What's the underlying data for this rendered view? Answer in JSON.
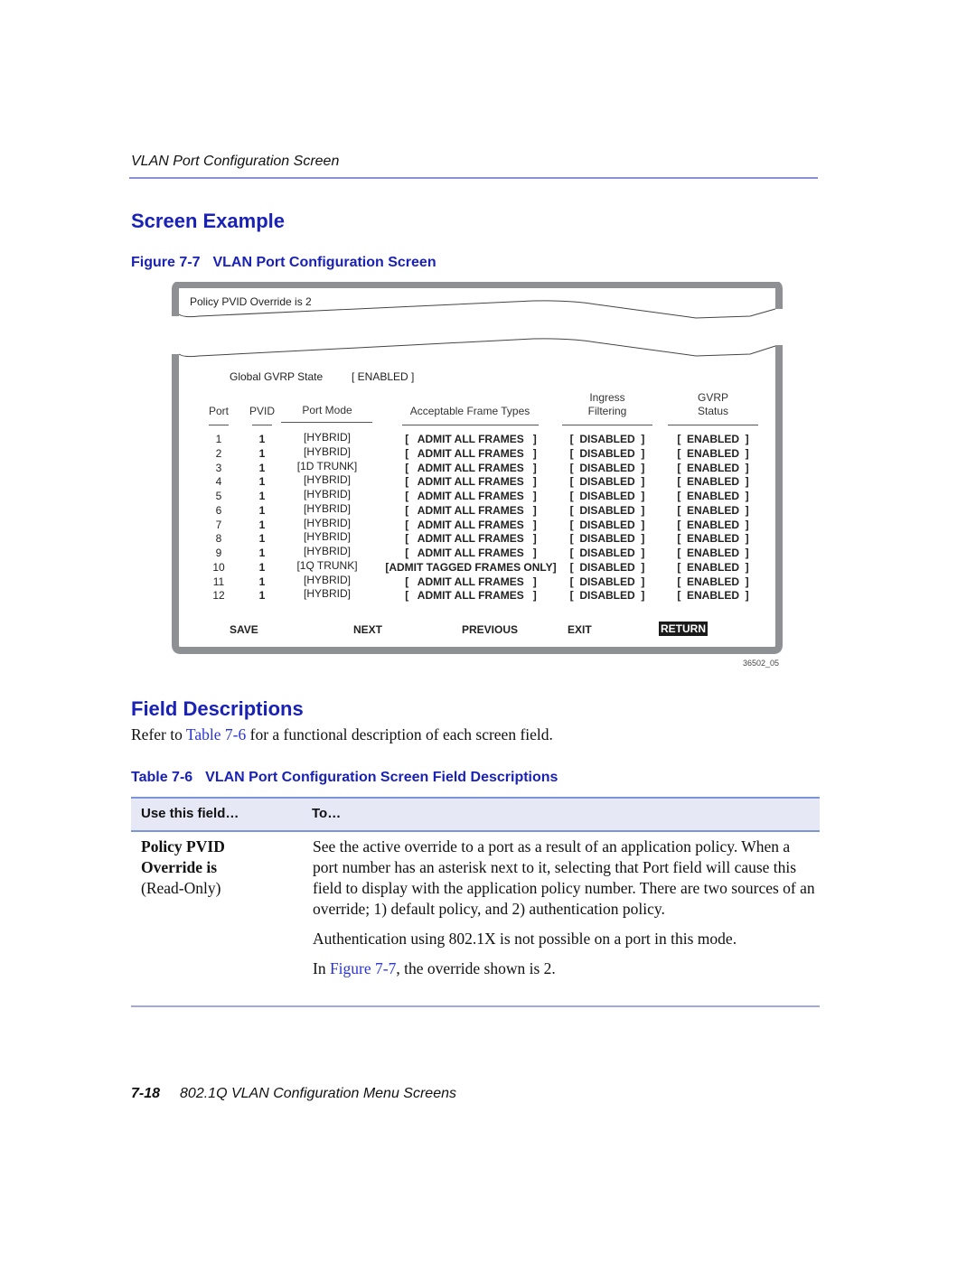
{
  "running_head": "VLAN Port Configuration Screen",
  "sections": {
    "screen_example": "Screen Example",
    "field_descriptions": "Field Descriptions"
  },
  "figure": {
    "number": "Figure 7-7",
    "title": "VLAN Port Configuration Screen",
    "id_label": "36502_05"
  },
  "screen": {
    "policy_line": "Policy PVID Override is 2",
    "global_gvrp_label": "Global GVRP State",
    "global_gvrp_value": "[ ENABLED ]",
    "columns": {
      "port": "Port",
      "pvid": "PVID",
      "port_mode": "Port Mode",
      "frame_types": "Acceptable Frame Types",
      "ingress_1": "Ingress",
      "ingress_2": "Filtering",
      "gvrp_1": "GVRP",
      "gvrp_2": "Status"
    },
    "rows": [
      {
        "port": "1",
        "pvid": "1",
        "mode": "[HYBRID]",
        "frames": "[   ADMIT ALL FRAMES   ]",
        "ingress": "[  DISABLED  ]",
        "gvrp": "[  ENABLED  ]"
      },
      {
        "port": "2",
        "pvid": "1",
        "mode": "[HYBRID]",
        "frames": "[   ADMIT ALL FRAMES   ]",
        "ingress": "[  DISABLED  ]",
        "gvrp": "[  ENABLED  ]"
      },
      {
        "port": "3",
        "pvid": "1",
        "mode": "[1D TRUNK]",
        "frames": "[   ADMIT ALL FRAMES   ]",
        "ingress": "[  DISABLED  ]",
        "gvrp": "[  ENABLED  ]"
      },
      {
        "port": "4",
        "pvid": "1",
        "mode": "[HYBRID]",
        "frames": "[   ADMIT ALL FRAMES   ]",
        "ingress": "[  DISABLED  ]",
        "gvrp": "[  ENABLED  ]"
      },
      {
        "port": "5",
        "pvid": "1",
        "mode": "[HYBRID]",
        "frames": "[   ADMIT ALL FRAMES   ]",
        "ingress": "[  DISABLED  ]",
        "gvrp": "[  ENABLED  ]"
      },
      {
        "port": "6",
        "pvid": "1",
        "mode": "[HYBRID]",
        "frames": "[   ADMIT ALL FRAMES   ]",
        "ingress": "[  DISABLED  ]",
        "gvrp": "[  ENABLED  ]"
      },
      {
        "port": "7",
        "pvid": "1",
        "mode": "[HYBRID]",
        "frames": "[   ADMIT ALL FRAMES   ]",
        "ingress": "[  DISABLED  ]",
        "gvrp": "[  ENABLED  ]"
      },
      {
        "port": "8",
        "pvid": "1",
        "mode": "[HYBRID]",
        "frames": "[   ADMIT ALL FRAMES   ]",
        "ingress": "[  DISABLED  ]",
        "gvrp": "[  ENABLED  ]"
      },
      {
        "port": "9",
        "pvid": "1",
        "mode": "[HYBRID]",
        "frames": "[   ADMIT ALL FRAMES   ]",
        "ingress": "[  DISABLED  ]",
        "gvrp": "[  ENABLED  ]"
      },
      {
        "port": "10",
        "pvid": "1",
        "mode": "[1Q TRUNK]",
        "frames": "[ADMIT TAGGED FRAMES ONLY]",
        "ingress": "[  DISABLED  ]",
        "gvrp": "[  ENABLED  ]"
      },
      {
        "port": "11",
        "pvid": "1",
        "mode": "[HYBRID]",
        "frames": "[   ADMIT ALL FRAMES   ]",
        "ingress": "[  DISABLED  ]",
        "gvrp": "[  ENABLED  ]"
      },
      {
        "port": "12",
        "pvid": "1",
        "mode": "[HYBRID]",
        "frames": "[   ADMIT ALL FRAMES   ]",
        "ingress": "[  DISABLED  ]",
        "gvrp": "[  ENABLED  ]"
      }
    ],
    "commands": {
      "save": "SAVE",
      "next": "NEXT",
      "previous": "PREVIOUS",
      "exit": "EXIT",
      "return": "RETURN"
    },
    "selected_command": "RETURN"
  },
  "body": {
    "refer_pre": "Refer to ",
    "refer_link": "Table 7-6",
    "refer_post": " for a functional description of each screen field."
  },
  "table": {
    "number": "Table 7-6",
    "title": "VLAN Port Configuration Screen Field Descriptions",
    "headers": [
      "Use this field…",
      "To…"
    ],
    "rows": [
      {
        "field_line1": "Policy PVID",
        "field_line2": "Override is",
        "field_note": "(Read-Only)",
        "desc_p1": "See the active override to a port as a result of an application policy. When a port number has an asterisk next to it, selecting that Port field will cause this field to display with the application policy number. There are two sources of an override; 1) default policy, and 2) authentication policy.",
        "desc_p2": "Authentication using 802.1X is not possible on a port in this mode.",
        "desc_p3_pre": "In ",
        "desc_p3_link": "Figure 7-7",
        "desc_p3_post": ", the override shown is 2."
      }
    ]
  },
  "footer": {
    "page": "7-18",
    "title": "802.1Q VLAN Configuration Menu Screens"
  },
  "colors": {
    "heading_blue": "#1a22b5",
    "link_blue": "#2a35d6",
    "frame_gray": "#8f9094",
    "table_header_bg": "#e6e8f6"
  }
}
